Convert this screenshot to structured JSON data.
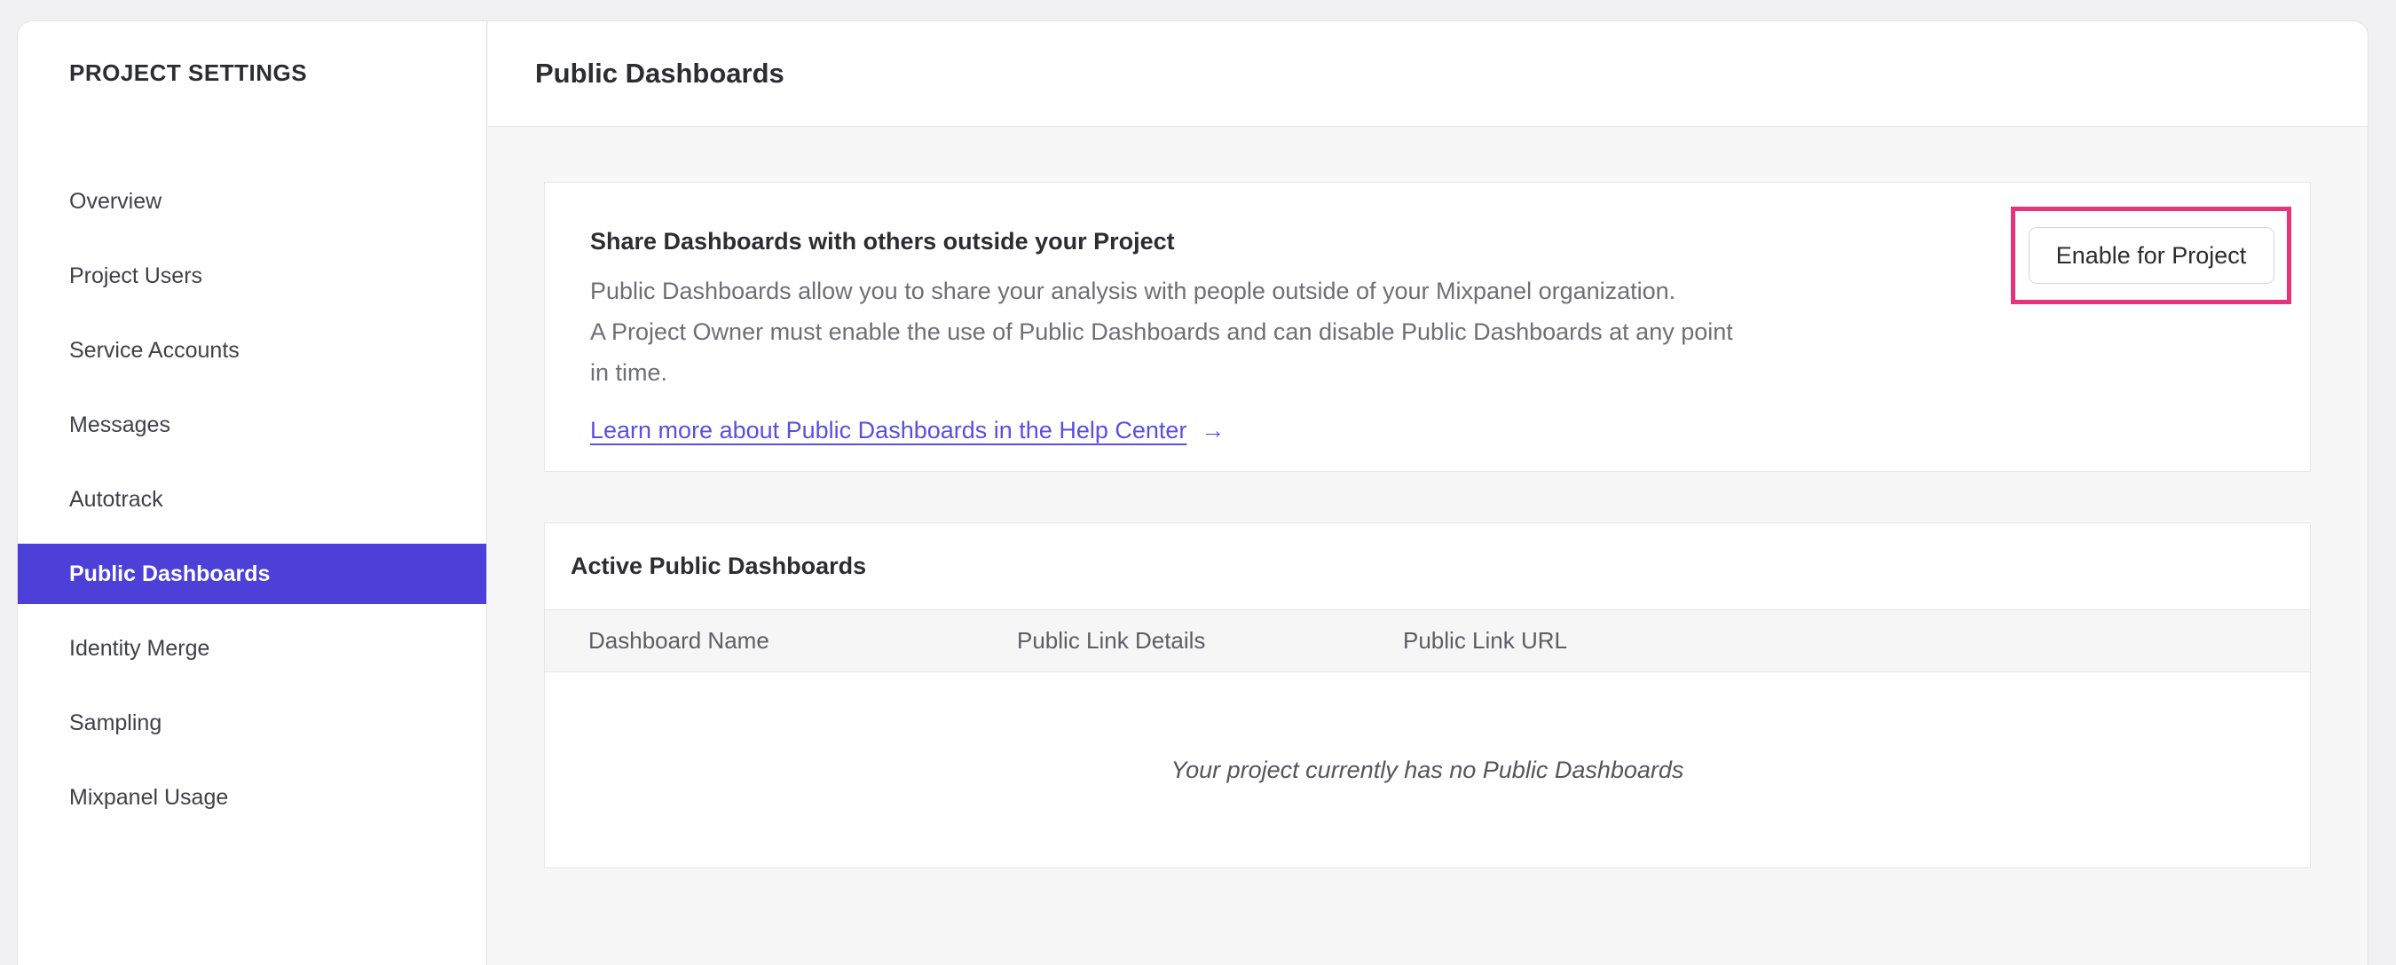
{
  "sidebar": {
    "title": "PROJECT SETTINGS",
    "items": [
      {
        "label": "Overview",
        "selected": false
      },
      {
        "label": "Project Users",
        "selected": false
      },
      {
        "label": "Service Accounts",
        "selected": false
      },
      {
        "label": "Messages",
        "selected": false
      },
      {
        "label": "Autotrack",
        "selected": false
      },
      {
        "label": "Public Dashboards",
        "selected": true
      },
      {
        "label": "Identity Merge",
        "selected": false
      },
      {
        "label": "Sampling",
        "selected": false
      },
      {
        "label": "Mixpanel Usage",
        "selected": false
      }
    ]
  },
  "header": {
    "title": "Public Dashboards"
  },
  "share_card": {
    "heading": "Share Dashboards with others outside your Project",
    "description_lines": [
      "Public Dashboards allow you to share your analysis with people outside of your Mixpanel organization.",
      "A Project Owner must enable the use of Public Dashboards and can disable Public Dashboards at any point",
      "in time."
    ],
    "link_label": "Learn more about Public Dashboards in the Help Center",
    "link_arrow": "→",
    "enable_button_label": "Enable for Project"
  },
  "active_card": {
    "heading": "Active Public Dashboards",
    "columns": [
      "Dashboard Name",
      "Public Link Details",
      "Public Link URL"
    ],
    "empty_message": "Your project currently has no Public Dashboards"
  },
  "colors": {
    "accent_purple": "#4c40d8",
    "link_purple": "#5a4fe0",
    "annotation_pink": "#e8327c"
  }
}
